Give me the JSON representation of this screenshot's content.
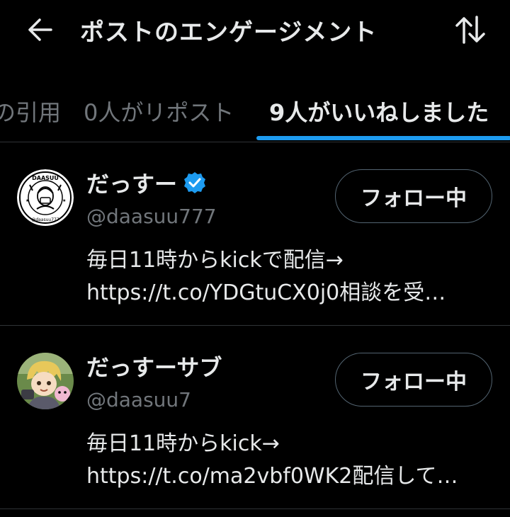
{
  "header": {
    "title": "ポストのエンゲージメント",
    "back_icon": "arrow-left-icon",
    "sort_icon": "sort-arrows-icon"
  },
  "tabs": [
    {
      "label": "の引用",
      "active": false
    },
    {
      "label": "0人がリポスト",
      "active": false
    },
    {
      "label": "9人がいいねしました",
      "active": true
    }
  ],
  "accent_color": "#1d9bf0",
  "users": [
    {
      "name": "だっすー",
      "verified": true,
      "handle": "@daasuu777",
      "bio_line1": "毎日11時からkickで配信→",
      "bio_line2": "https://t.co/YDGtuCX0j0相談を受…",
      "follow_label": "フォロー中",
      "avatar_text_top": "DAASUU",
      "avatar_text_bottom": "@daasuu777"
    },
    {
      "name": "だっすーサブ",
      "verified": false,
      "handle": "@daasuu7",
      "bio_line1": "毎日11時からkick→",
      "bio_line2": "https://t.co/ma2vbf0WK2配信して…",
      "follow_label": "フォロー中"
    }
  ]
}
